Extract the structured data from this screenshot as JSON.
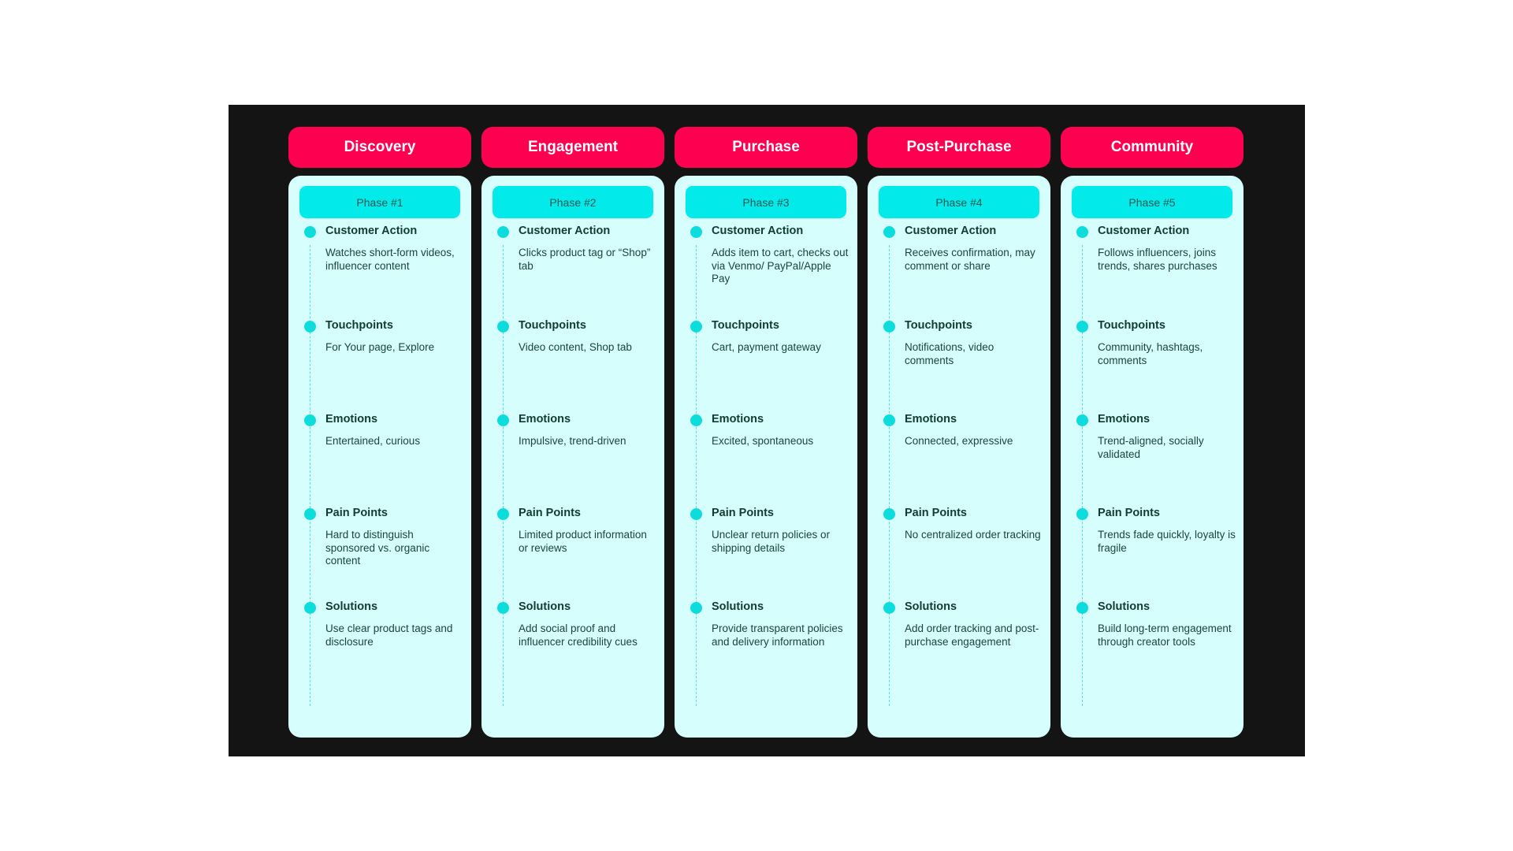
{
  "colors": {
    "board": "#141414",
    "header": "#fe0050",
    "card": "#d6fefd",
    "pill": "#02eaea",
    "dot": "#0ddcdc",
    "text": "#0f3d33"
  },
  "phases": [
    {
      "name": "Discovery",
      "phase": "Phase #1",
      "stages": [
        {
          "title": "Customer Action",
          "text": "Watches short-form videos, influencer content"
        },
        {
          "title": "Touchpoints",
          "text": "For Your page, Explore"
        },
        {
          "title": "Emotions",
          "text": "Entertained, curious"
        },
        {
          "title": "Pain Points",
          "text": "Hard to distinguish sponsored vs. organic content"
        },
        {
          "title": "Solutions",
          "text": "Use clear product tags and disclosure"
        }
      ]
    },
    {
      "name": "Engagement",
      "phase": "Phase #2",
      "stages": [
        {
          "title": "Customer Action",
          "text": "Clicks product tag or “Shop” tab"
        },
        {
          "title": "Touchpoints",
          "text": "Video content, Shop tab"
        },
        {
          "title": "Emotions",
          "text": "Impulsive, trend-driven"
        },
        {
          "title": "Pain Points",
          "text": "Limited product information or reviews"
        },
        {
          "title": "Solutions",
          "text": "Add social proof and influencer credibility cues"
        }
      ]
    },
    {
      "name": "Purchase",
      "phase": "Phase #3",
      "stages": [
        {
          "title": "Customer Action",
          "text": "Adds item to cart, checks out via Venmo/ PayPal/Apple Pay"
        },
        {
          "title": "Touchpoints",
          "text": "Cart, payment gateway"
        },
        {
          "title": "Emotions",
          "text": "Excited, spontaneous"
        },
        {
          "title": "Pain Points",
          "text": "Unclear return policies or shipping details"
        },
        {
          "title": "Solutions",
          "text": "Provide transparent policies and delivery information"
        }
      ]
    },
    {
      "name": "Post-Purchase",
      "phase": "Phase #4",
      "stages": [
        {
          "title": "Customer Action",
          "text": "Receives confirmation, may comment or share"
        },
        {
          "title": "Touchpoints",
          "text": "Notifications, video comments"
        },
        {
          "title": "Emotions",
          "text": "Connected, expressive"
        },
        {
          "title": "Pain Points",
          "text": "No centralized order tracking"
        },
        {
          "title": "Solutions",
          "text": "Add order tracking and post-purchase engagement"
        }
      ]
    },
    {
      "name": "Community",
      "phase": "Phase #5",
      "stages": [
        {
          "title": "Customer Action",
          "text": "Follows influencers, joins trends, shares purchases"
        },
        {
          "title": "Touchpoints",
          "text": "Community, hashtags, comments"
        },
        {
          "title": "Emotions",
          "text": "Trend-aligned, socially validated"
        },
        {
          "title": "Pain Points",
          "text": "Trends fade quickly, loyalty is fragile"
        },
        {
          "title": "Solutions",
          "text": "Build long-term engagement through creator tools"
        }
      ]
    }
  ]
}
